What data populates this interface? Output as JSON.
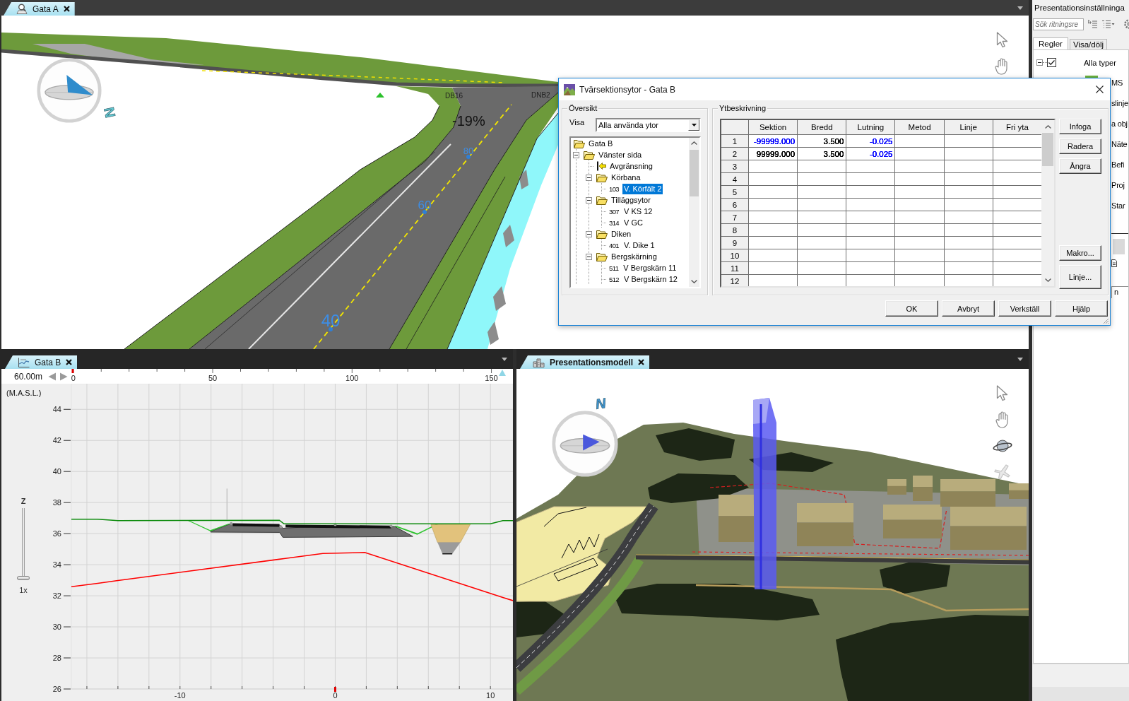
{
  "top_view": {
    "tab": {
      "label": "Gata A",
      "active": false
    },
    "road_tags": [
      "DB16",
      "DNB2"
    ],
    "grade": "-19%",
    "stations": [
      "80",
      "60",
      "40"
    ],
    "compass_label": "N"
  },
  "profile_view": {
    "tab": {
      "label": "Gata B",
      "active": false
    },
    "scale": "60.00m",
    "ruler_ticks": [
      "0",
      "50",
      "100",
      "150"
    ],
    "zoom": {
      "label": "Z",
      "level": 0,
      "reading": "1x"
    },
    "chart_data": {
      "type": "line",
      "ylabel": "(M.A.S.L.)",
      "x": [
        -17,
        -15.3,
        -14,
        -3.6,
        -3.3,
        -0.8,
        1.9,
        10,
        10.8,
        11.45
      ],
      "series": [
        {
          "color": "#0a8a0a",
          "values": [
            36.93,
            36.93,
            36.84,
            36.86,
            36.63,
            36.63,
            36.63,
            36.63,
            36.84,
            36.84
          ]
        },
        {
          "color": "#ff0000",
          "values": [
            32.58,
            32.8,
            32.98,
            34.35,
            34.39,
            34.72,
            34.79,
            32.15,
            31.89,
            31.69
          ]
        }
      ],
      "xlim": [
        -17,
        11.45
      ],
      "ylim": [
        26,
        45.65
      ],
      "xticks": [
        -10,
        0,
        10
      ],
      "yticks": [
        26,
        28,
        30,
        32,
        34,
        36,
        38,
        40,
        42,
        44
      ],
      "grid": true
    }
  },
  "model_view": {
    "tab": {
      "label": "Presentationsmodell",
      "active": true
    },
    "compass_label": "N"
  },
  "settings_panel": {
    "title": "Presentationsinställninga",
    "search": {
      "placeholder": "Sök ritningsre"
    },
    "tabs": [
      {
        "label": "Regler",
        "selected": true
      },
      {
        "label": "Visa/dölj",
        "selected": false
      }
    ],
    "root": {
      "label": "Alla typer",
      "checked": true,
      "expanded": true
    },
    "items": [
      "MS",
      "slinje",
      "a obj",
      "Näte",
      "Befi",
      "Proj",
      "Star"
    ],
    "lower_tab": "n"
  },
  "dialog": {
    "title": "Tvärsektionsytor - Gata B",
    "overview": {
      "title": "Översikt",
      "filter_label": "Visa",
      "filter_value": "Alla använda ytor",
      "tree": [
        {
          "label": "Gata B",
          "kind": "folder",
          "selected": false,
          "children": [
            {
              "label": "Vänster sida",
              "kind": "folder",
              "expanded": true,
              "selected": false,
              "children": [
                {
                  "label": "Avgränsning",
                  "kind": "boundary",
                  "selected": false
                },
                {
                  "label": "Körbana",
                  "kind": "folder",
                  "expanded": true,
                  "selected": false,
                  "children": [
                    {
                      "code": "103",
                      "label": "V. Körfält 2",
                      "kind": "area",
                      "selected": true
                    }
                  ]
                },
                {
                  "label": "Tilläggsytor",
                  "kind": "folder",
                  "expanded": true,
                  "selected": false,
                  "children": [
                    {
                      "code": "307",
                      "label": "V KS 12",
                      "kind": "area",
                      "selected": false
                    },
                    {
                      "code": "314",
                      "label": "V GC",
                      "kind": "area",
                      "selected": false
                    }
                  ]
                },
                {
                  "label": "Diken",
                  "kind": "folder",
                  "expanded": true,
                  "selected": false,
                  "children": [
                    {
                      "code": "401",
                      "label": "V. Dike 1",
                      "kind": "area",
                      "selected": false
                    }
                  ]
                },
                {
                  "label": "Bergskärning",
                  "kind": "folder",
                  "expanded": true,
                  "selected": false,
                  "children": [
                    {
                      "code": "511",
                      "label": "V Bergskärn 11",
                      "kind": "area",
                      "selected": false
                    },
                    {
                      "code": "512",
                      "label": "V Bergskärn 12",
                      "kind": "area",
                      "selected": false
                    }
                  ]
                }
              ]
            }
          ]
        }
      ]
    },
    "description": {
      "title": "Ytbeskrivning",
      "columns": [
        "Sektion",
        "Bredd",
        "Lutning",
        "Metod",
        "Linje",
        "Fri yta"
      ],
      "rows": [
        {
          "number": "1",
          "cells": [
            {
              "text": "-99999.000",
              "color": "#0000ff"
            },
            {
              "text": "3.500",
              "color": "#000000"
            },
            {
              "text": "-0.025",
              "color": "#0000ff"
            }
          ]
        },
        {
          "number": "2",
          "cells": [
            {
              "text": "99999.000",
              "color": "#000000"
            },
            {
              "text": "3.500",
              "color": "#000000"
            },
            {
              "text": "-0.025",
              "color": "#0000ff"
            }
          ]
        },
        {
          "number": "3"
        },
        {
          "number": "4"
        },
        {
          "number": "5"
        },
        {
          "number": "6"
        },
        {
          "number": "7"
        },
        {
          "number": "8"
        },
        {
          "number": "9"
        },
        {
          "number": "10"
        },
        {
          "number": "11"
        },
        {
          "number": "12"
        }
      ],
      "edit_buttons": [
        "Infoga",
        "Radera",
        "Ångra"
      ],
      "tool_buttons": [
        "Makro...",
        "Linje..."
      ]
    },
    "buttons": [
      "OK",
      "Avbryt",
      "Verkställ",
      "Hjälp"
    ]
  }
}
